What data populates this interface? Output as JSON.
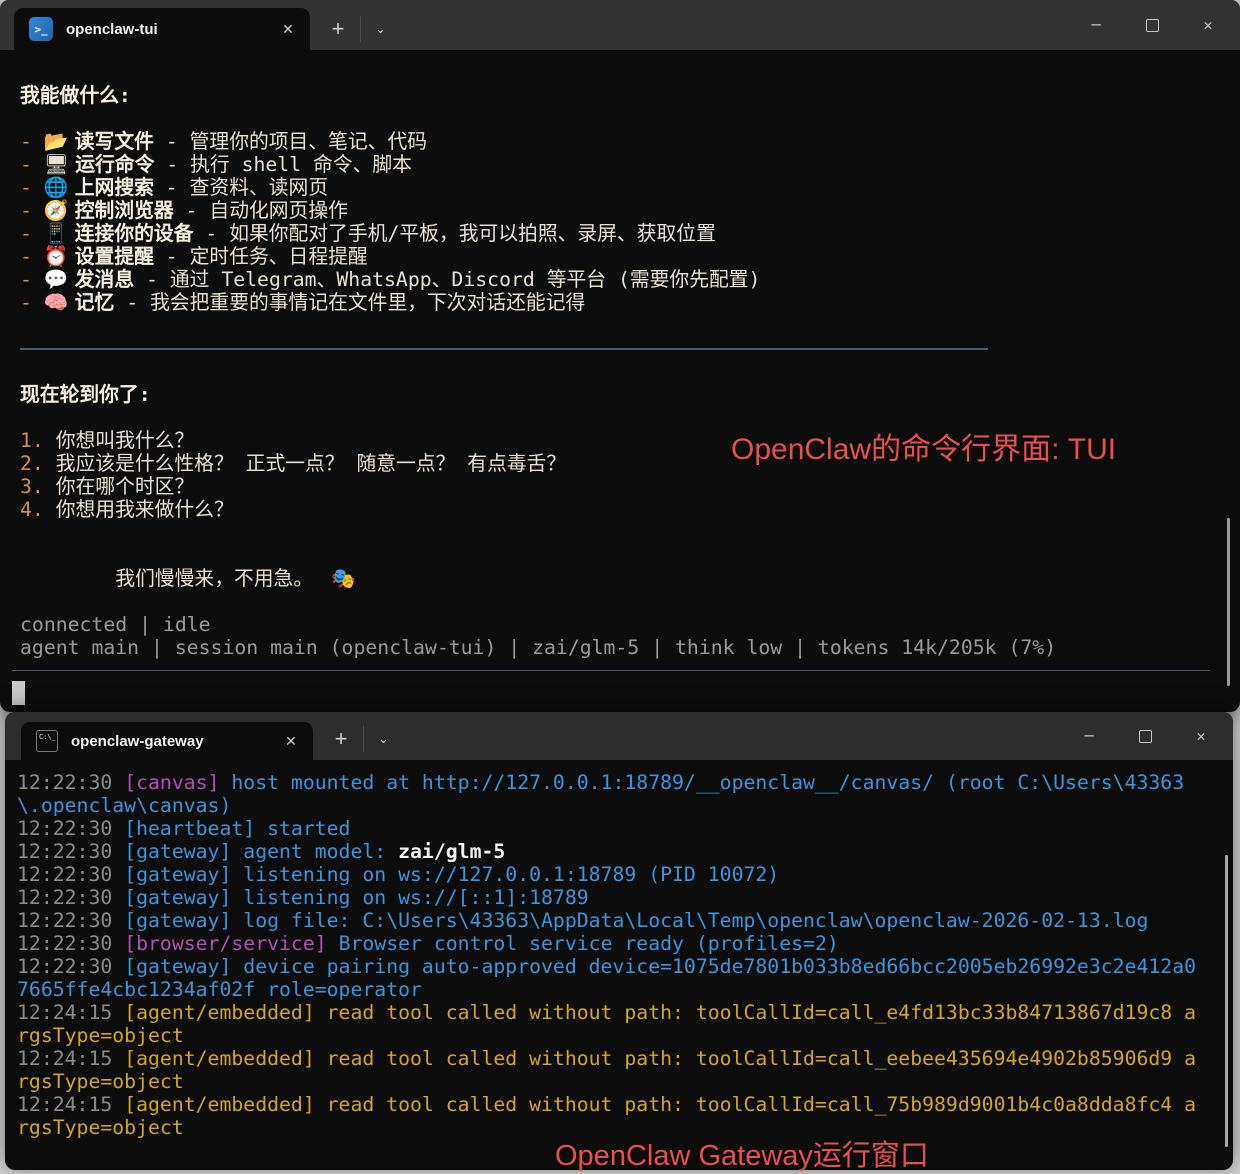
{
  "tui_window": {
    "tab_title": "openclaw-tui",
    "annotation": "OpenClaw的命令行界面: TUI",
    "icons": {
      "close": "✕",
      "new_tab": "+",
      "tab_dropdown": "⌄",
      "minimize": "─",
      "ps_glyph": ">_",
      "cmd_glyph": "C:\\_"
    },
    "sections": {
      "capabilities_header": "我能做什么:",
      "capabilities": [
        {
          "icon": "open-folder",
          "emoji": "📂",
          "title": "读写文件",
          "desc": "管理你的项目、笔记、代码"
        },
        {
          "icon": "desktop-computer",
          "emoji": "🖥",
          "title": "运行命令",
          "desc": "执行 shell 命令、脚本"
        },
        {
          "icon": "globe",
          "emoji": "🌐",
          "title": "上网搜索",
          "desc": "查资料、读网页"
        },
        {
          "icon": "compass",
          "emoji": "🧭",
          "title": "控制浏览器",
          "desc": "自动化网页操作"
        },
        {
          "icon": "mobile-phone",
          "emoji": "📱",
          "title": "连接你的设备",
          "desc": "如果你配对了手机/平板，我可以拍照、录屏、获取位置"
        },
        {
          "icon": "alarm-clock",
          "emoji": "⏰",
          "title": "设置提醒",
          "desc": "定时任务、日程提醒"
        },
        {
          "icon": "speech-balloon",
          "emoji": "💬",
          "title": "发消息",
          "desc": "通过 Telegram、WhatsApp、Discord 等平台 (需要你先配置)"
        },
        {
          "icon": "brain",
          "emoji": "🧠",
          "title": "记忆",
          "desc": "我会把重要的事情记在文件里，下次对话还能记得"
        }
      ],
      "turn_header": "现在轮到你了:",
      "questions": [
        "你想叫我什么？",
        "我应该是什么性格？ 正式一点？ 随意一点？ 有点毒舌？",
        "你在哪个时区？",
        "你想用我来做什么？"
      ],
      "closing_text": "我们慢慢来，不用急。",
      "closing_emoji": "🎭",
      "status_line1": "connected | idle",
      "status_line2": "agent main | session main (openclaw-tui) | zai/glm-5 | think low | tokens 14k/205k (7%)"
    }
  },
  "gateway_window": {
    "tab_title": "openclaw-gateway",
    "annotation": "OpenClaw Gateway运行窗口",
    "log_colors": {
      "blue": "#3a96dd",
      "magenta": "#b150b8",
      "yellow": "#d2a81c",
      "white": "#f2f2f2",
      "time_gray": "#8b8b8b"
    },
    "logs": [
      {
        "time": "12:22:30",
        "segments": [
          {
            "text": "[canvas]",
            "color": "magenta"
          },
          {
            "text": " host mounted at http://127.0.0.1:18789/__openclaw__/canvas/ (root C:\\Users\\43363\\.openclaw\\canvas)",
            "color": "blue"
          }
        ]
      },
      {
        "time": "12:22:30",
        "segments": [
          {
            "text": "[heartbeat] started",
            "color": "blue"
          }
        ]
      },
      {
        "time": "12:22:30",
        "segments": [
          {
            "text": "[gateway] agent model: ",
            "color": "blue"
          },
          {
            "text": "zai/glm-5",
            "color": "white",
            "bold": true
          }
        ]
      },
      {
        "time": "12:22:30",
        "segments": [
          {
            "text": "[gateway] listening on ws://127.0.0.1:18789 (PID 10072)",
            "color": "blue"
          }
        ]
      },
      {
        "time": "12:22:30",
        "segments": [
          {
            "text": "[gateway] listening on ws://[::1]:18789",
            "color": "blue"
          }
        ]
      },
      {
        "time": "12:22:30",
        "segments": [
          {
            "text": "[gateway] log file: C:\\Users\\43363\\AppData\\Local\\Temp\\openclaw\\openclaw-2026-02-13.log",
            "color": "blue"
          }
        ]
      },
      {
        "time": "12:22:30",
        "segments": [
          {
            "text": "[browser/service]",
            "color": "magenta"
          },
          {
            "text": " Browser control service ready (profiles=2)",
            "color": "blue"
          }
        ]
      },
      {
        "time": "12:22:30",
        "segments": [
          {
            "text": "[gateway] device pairing auto-approved device=1075de7801b033b8ed66bcc2005eb26992e3c2e412a07665ffe4cbc1234af02f role=operator",
            "color": "blue"
          }
        ]
      },
      {
        "time": "12:24:15",
        "segments": [
          {
            "text": "[agent/embedded] read tool called without path: toolCallId=call_e4fd13bc33b84713867d19c8 argsType=object",
            "color": "yellow"
          }
        ]
      },
      {
        "time": "12:24:15",
        "segments": [
          {
            "text": "[agent/embedded] read tool called without path: toolCallId=call_eebee435694e4902b85906d9 argsType=object",
            "color": "yellow"
          }
        ]
      },
      {
        "time": "12:24:15",
        "segments": [
          {
            "text": "[agent/embedded] read tool called without path: toolCallId=call_75b989d9001b4c0a8dda8fc4 argsType=object",
            "color": "yellow"
          }
        ]
      }
    ]
  }
}
